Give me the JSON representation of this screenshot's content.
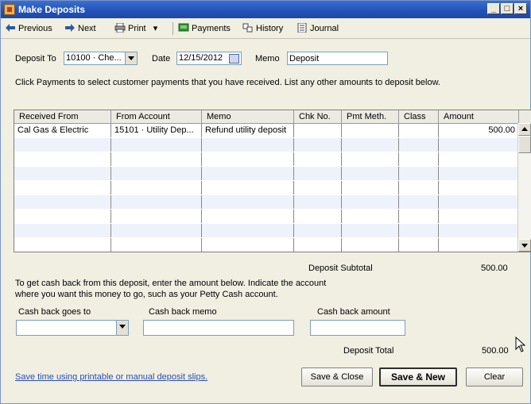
{
  "window": {
    "title": "Make Deposits"
  },
  "toolbar": {
    "previous": "Previous",
    "next": "Next",
    "print": "Print",
    "payments": "Payments",
    "history": "History",
    "journal": "Journal"
  },
  "header": {
    "deposit_to_label": "Deposit To",
    "deposit_to_value": "10100 · Che...",
    "date_label": "Date",
    "date_value": "12/15/2012",
    "memo_label": "Memo",
    "memo_value": "Deposit"
  },
  "instructions": "Click Payments to select customer payments that you have received. List any other amounts to deposit below.",
  "table": {
    "columns": [
      "Received From",
      "From Account",
      "Memo",
      "Chk No.",
      "Pmt Meth.",
      "Class",
      "Amount"
    ],
    "rows": [
      [
        "Cal Gas & Electric",
        "15101 · Utility Dep...",
        "Refund utility deposit",
        "",
        "",
        "",
        "500.00"
      ]
    ]
  },
  "subtotal": {
    "label": "Deposit Subtotal",
    "value": "500.00"
  },
  "cashback": {
    "instructions_line1": "To get cash back from this deposit, enter the amount below.  Indicate the account",
    "instructions_line2": "where you want this money to go, such as your Petty Cash account.",
    "goes_to_label": "Cash back goes to",
    "goes_to_value": "",
    "memo_label": "Cash back memo",
    "memo_value": "",
    "amount_label": "Cash back amount",
    "amount_value": ""
  },
  "total": {
    "label": "Deposit Total",
    "value": "500.00"
  },
  "footer": {
    "link": "Save time using printable or manual deposit slips.",
    "save_close": "Save & Close",
    "save_new": "Save & New",
    "clear": "Clear"
  },
  "colors": {
    "titlebar": "#2353b8",
    "link": "#2a4fb0",
    "grid_alt_row": "#eef3fb"
  }
}
